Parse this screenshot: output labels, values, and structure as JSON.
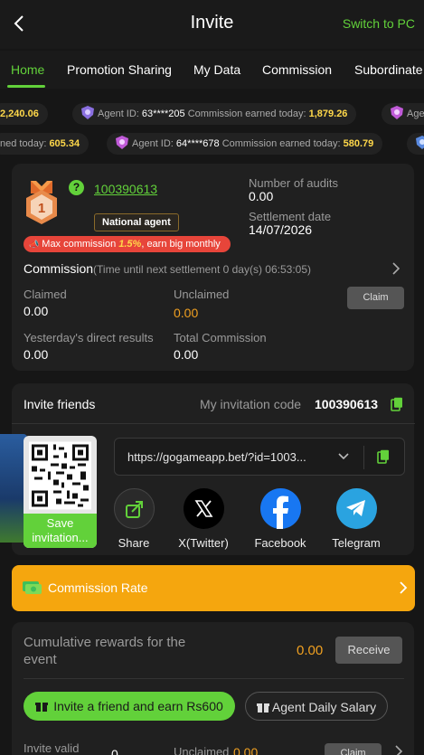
{
  "header": {
    "title": "Invite",
    "switch_label": "Switch to PC"
  },
  "tabs": [
    {
      "label": "Home",
      "active": true
    },
    {
      "label": "Promotion Sharing",
      "active": false
    },
    {
      "label": "My Data",
      "active": false
    },
    {
      "label": "Commission",
      "active": false
    },
    {
      "label": "Subordinate",
      "active": false
    }
  ],
  "ticker_rows": [
    [
      {
        "prefix": "",
        "agent": "",
        "mid": "",
        "amount": "2,240.06"
      },
      {
        "prefix": "Agent ID: ",
        "agent": "63****205",
        "mid": "Commission earned today: ",
        "amount": "1,879.26"
      },
      {
        "prefix": "Age",
        "agent": "",
        "mid": "",
        "amount": ""
      }
    ],
    [
      {
        "prefix": "",
        "agent": "",
        "mid": "ned today: ",
        "amount": "605.34"
      },
      {
        "prefix": "Agent ID: ",
        "agent": "64****678",
        "mid": "Commission earned today: ",
        "amount": "580.79"
      }
    ]
  ],
  "agent": {
    "level": "1",
    "id": "100390613",
    "badge": "National agent",
    "max_commission": {
      "before": "Max commission ",
      "pct": "1.5%",
      "after": ", earn big monthly"
    },
    "audits_label": "Number of audits",
    "audits_value": "0.00",
    "settlement_label": "Settlement date",
    "settlement_value": "14/07/2026"
  },
  "commission": {
    "title": "Commission",
    "next_settlement": "(Time until next settlement  0 day(s) 06:53:05)",
    "claimed_label": "Claimed",
    "claimed_value": "0.00",
    "unclaimed_label": "Unclaimed",
    "unclaimed_value": "0.00",
    "claim_label": "Claim",
    "yesterday_label": "Yesterday's direct results",
    "yesterday_value": "0.00",
    "total_label": "Total Commission",
    "total_value": "0.00"
  },
  "invite": {
    "title": "Invite friends",
    "code_label": "My invitation code",
    "code_value": "100390613",
    "save_label": "Save invitation...",
    "url": "https://gogameapp.bet/?id=1003...",
    "share": [
      {
        "name": "Share",
        "icon": "share-icon",
        "color": "#2a2a2a"
      },
      {
        "name": "X(Twitter)",
        "icon": "x-twitter-icon",
        "color": "#000000"
      },
      {
        "name": "Facebook",
        "icon": "facebook-icon",
        "color": "#1877f2"
      },
      {
        "name": "Telegram",
        "icon": "telegram-icon",
        "color": "#2aa3e0"
      }
    ]
  },
  "commission_rate": {
    "label": "Commission Rate"
  },
  "event": {
    "cumulative_label": "Cumulative rewards for the event",
    "cumulative_value": "0.00",
    "receive_label": "Receive",
    "invite_earn_label": "Invite a friend and earn Rs600",
    "daily_salary_label": "Agent Daily Salary",
    "valid_label": "Invite valid",
    "valid_value": "0",
    "unclaimed_label": "Unclaimed",
    "unclaimed_value": "0.00",
    "claim_label": "Claim"
  },
  "colors": {
    "accent": "#62d13a",
    "orange": "#f0a020",
    "gold": "#ffd84a",
    "banner": "#f5a60e",
    "danger": "#e7453a"
  }
}
